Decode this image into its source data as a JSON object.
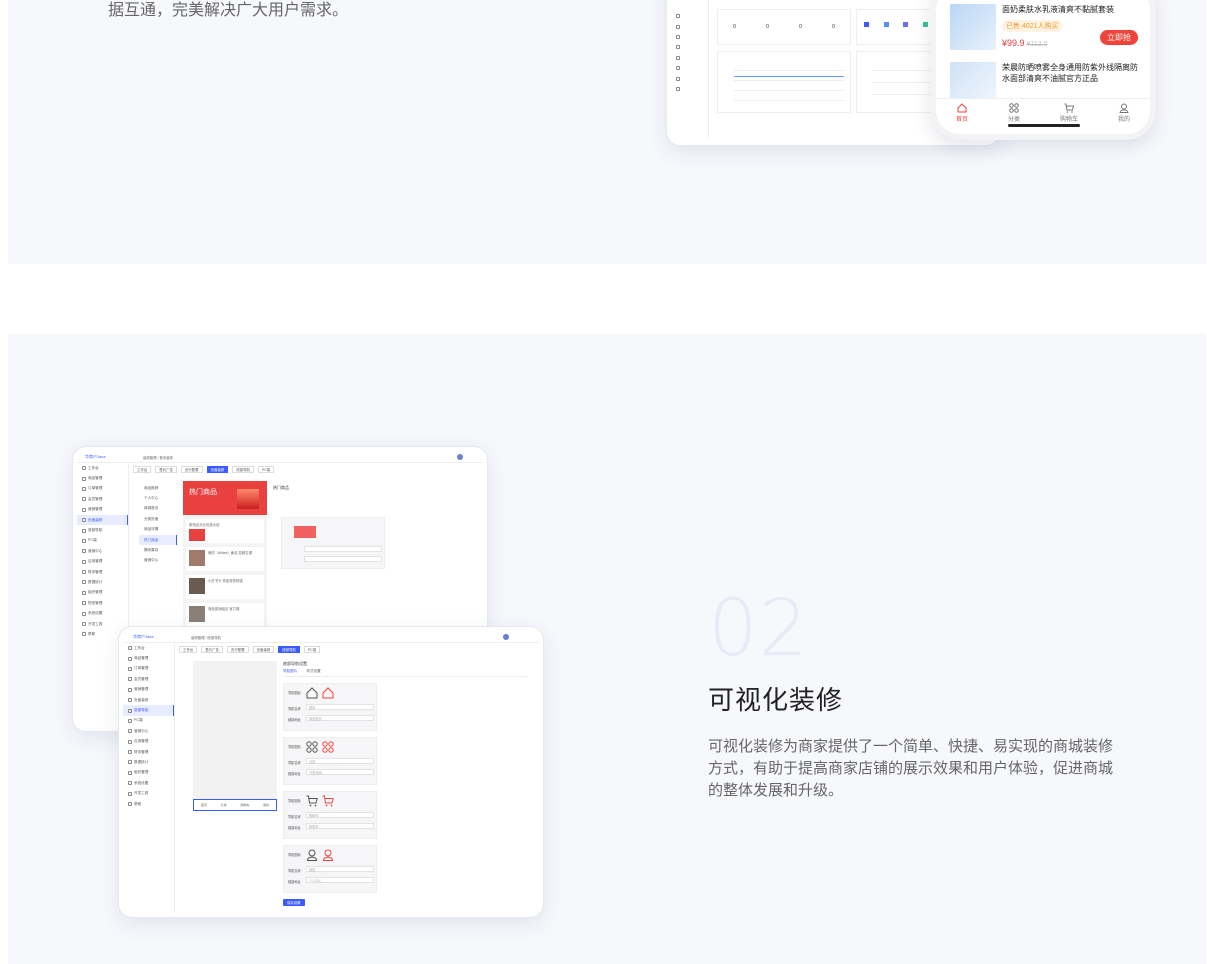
{
  "section1": {
    "intro_text": "据互通，完美解决广大用户需求。"
  },
  "phone": {
    "product1": {
      "title": "面奶柔肤水乳液清爽不黏腻套装",
      "sold": "已售 4021人购买",
      "price": "¥99.9",
      "orig_price": "¥112.0",
      "buy_label": "立即抢"
    },
    "product2": {
      "title": "荣晨防晒喷雾全身通用防紫外线隔离防水面部清爽不油腻官方正品"
    },
    "nav": [
      {
        "label": "首页",
        "icon": "home-icon"
      },
      {
        "label": "分类",
        "icon": "grid-icon"
      },
      {
        "label": "购物车",
        "icon": "cart-icon"
      },
      {
        "label": "我的",
        "icon": "user-icon"
      }
    ]
  },
  "feature": {
    "number": "02",
    "title": "可视化装修",
    "description": "可视化装修为商家提供了一个简单、快捷、易实现的商城装修方式，有助于提高商家店铺的展示效果和用户体验，促进商城的整体发展和升级。"
  },
  "mock_back": {
    "logo": "华商户Java",
    "breadcrumb": "装修管理 / 首页装修",
    "tabs": [
      "工作台",
      "签约广告",
      "页行配置",
      "页面装修",
      "底部导航",
      "PC端"
    ],
    "sidebar": [
      "工作台",
      "商品管理",
      "订单管理",
      "会员管理",
      "营销管理",
      "页面装修",
      "底部导航",
      "PC端",
      "营销中心",
      "应用管理",
      "财务管理",
      "数据统计",
      "组织管理",
      "短信管理",
      "系统设置",
      "开发工具",
      "帮助"
    ],
    "menu": [
      "商品推荐",
      "个人中心",
      "商城首页",
      "分类页面",
      "商品详情",
      "热门商品",
      "猜你喜欢",
      "营销中心"
    ],
    "banner_title": "热门商品",
    "panel_title": "热门商品",
    "products": [
      "家电百分比优惠大促",
      "美的（Midea）面包 变频空调",
      "小红书卡 商品零售精选",
      "商品促销组合 官方旗"
    ]
  },
  "mock_front": {
    "logo": "华商户Java",
    "breadcrumb": "装修管理 / 底部导航",
    "tabs": [
      "工作台",
      "签约广告",
      "页行配置",
      "页面装修",
      "底部导航",
      "PC端"
    ],
    "sidebar": [
      "工作台",
      "商品管理",
      "订单管理",
      "会员管理",
      "营销管理",
      "页面装修",
      "底部导航",
      "PC端",
      "营销中心",
      "应用管理",
      "财务管理",
      "数据统计",
      "组织管理",
      "系统设置",
      "开发工具",
      "帮助"
    ],
    "panel_title": "底部导航设置",
    "subtabs": [
      "导航图片",
      "样式设置"
    ],
    "nav_items": [
      {
        "name": "首页",
        "link": "商品首页"
      },
      {
        "name": "分类",
        "link": "分类页面"
      },
      {
        "name": "购物车",
        "link": "购物车"
      },
      {
        "name": "我的",
        "link": "个人中心"
      }
    ],
    "labels": {
      "icon": "导航图标",
      "name": "导航名称",
      "link": "链接地址"
    },
    "save_label": "保存设置",
    "phone_nav": [
      "首页",
      "分类",
      "购物车",
      "我的"
    ]
  },
  "colors": {
    "accent": "#3b5bfd",
    "red": "#f0433a",
    "bg": "#f7f8fc"
  }
}
